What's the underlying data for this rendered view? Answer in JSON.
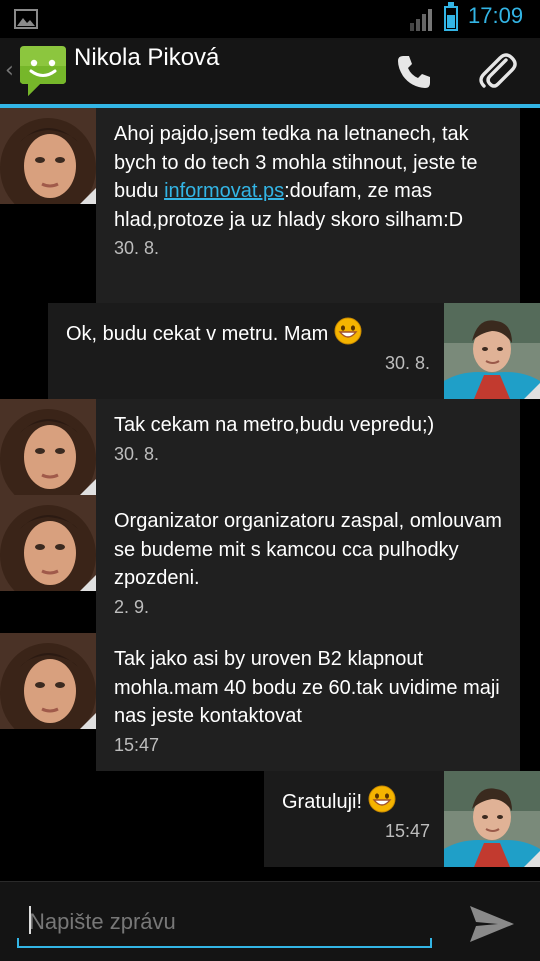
{
  "status_bar": {
    "time": "17:09",
    "notification_icon": "gallery-icon",
    "signal_icon": "signal-icon",
    "battery_icon": "battery-icon",
    "battery_level": 0.6,
    "accent": "#33b5e5"
  },
  "action_bar": {
    "up_icon": "back-chevron-icon",
    "app_icon": "messaging-app-icon",
    "title": "Nikola Piková",
    "call_icon": "phone-icon",
    "attach_icon": "paperclip-icon"
  },
  "messages": [
    {
      "direction": "incoming",
      "text_before_link": "Ahoj pajdo,jsem tedka na letnanech, tak bych to do tech 3 mohla stihnout, jeste te budu ",
      "link": "informovat.ps",
      "text_after_link": ":doufam, ze mas hlad,protoze ja uz hlady skoro silham:D",
      "time": "30. 8."
    },
    {
      "direction": "outgoing",
      "text": "Ok, budu cekat v metru. Mam",
      "emoji": "grinning-emoji-icon",
      "time": "30. 8."
    },
    {
      "direction": "incoming",
      "text": "Tak cekam na metro,budu vepredu;)",
      "time": "30. 8."
    },
    {
      "direction": "incoming",
      "text": "Organizator organizatoru zaspal, omlouvam se budeme mit s kamcou cca pulhodky zpozdeni.",
      "time": "2. 9."
    },
    {
      "direction": "incoming",
      "text": "Tak jako asi by uroven B2 klapnout mohla.mam 40 bodu ze 60.tak uvidime maji nas jeste kontaktovat",
      "time": "15:47"
    },
    {
      "direction": "outgoing",
      "text": "Gratuluji!",
      "emoji": "grinning-emoji-icon",
      "time": "15:47"
    }
  ],
  "compose": {
    "placeholder": "Napište zprávu",
    "value": "",
    "send_icon": "send-icon"
  },
  "colors": {
    "accent": "#33b5e5",
    "incoming_bubble": "#202020",
    "outgoing_bubble": "#1b1b1b",
    "link": "#33b5e5"
  }
}
